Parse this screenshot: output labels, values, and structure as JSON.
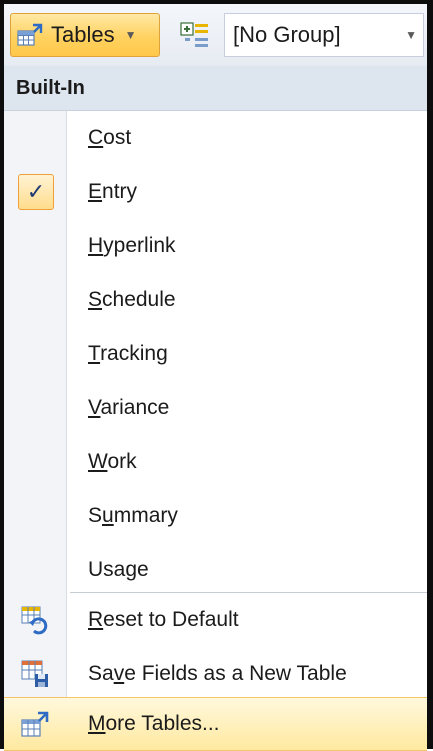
{
  "toolbar": {
    "tables_label": "Tables",
    "group_value": "[No Group]"
  },
  "menu": {
    "section_header": "Built-In",
    "items": [
      {
        "pre": "",
        "mnemonic": "C",
        "post": "ost",
        "checked": false
      },
      {
        "pre": "",
        "mnemonic": "E",
        "post": "ntry",
        "checked": true
      },
      {
        "pre": "",
        "mnemonic": "H",
        "post": "yperlink",
        "checked": false
      },
      {
        "pre": "",
        "mnemonic": "S",
        "post": "chedule",
        "checked": false
      },
      {
        "pre": "",
        "mnemonic": "T",
        "post": "racking",
        "checked": false
      },
      {
        "pre": "",
        "mnemonic": "V",
        "post": "ariance",
        "checked": false
      },
      {
        "pre": "",
        "mnemonic": "W",
        "post": "ork",
        "checked": false
      },
      {
        "pre": "S",
        "mnemonic": "u",
        "post": "mmary",
        "checked": false
      },
      {
        "pre": "Usa",
        "mnemonic": "g",
        "post": "e",
        "checked": false
      }
    ],
    "check_glyph": "✓",
    "commands": [
      {
        "pre": "",
        "mnemonic": "R",
        "post": "eset to Default",
        "icon": "reset-table-icon"
      },
      {
        "pre": "Sa",
        "mnemonic": "v",
        "post": "e Fields as a New Table",
        "icon": "save-table-icon"
      },
      {
        "pre": "",
        "mnemonic": "M",
        "post": "ore Tables...",
        "icon": "more-tables-icon",
        "highlighted": true
      }
    ]
  },
  "colors": {
    "accent": "#ffd260",
    "header_bg": "#dde5ef",
    "check": "#1f3a72"
  }
}
